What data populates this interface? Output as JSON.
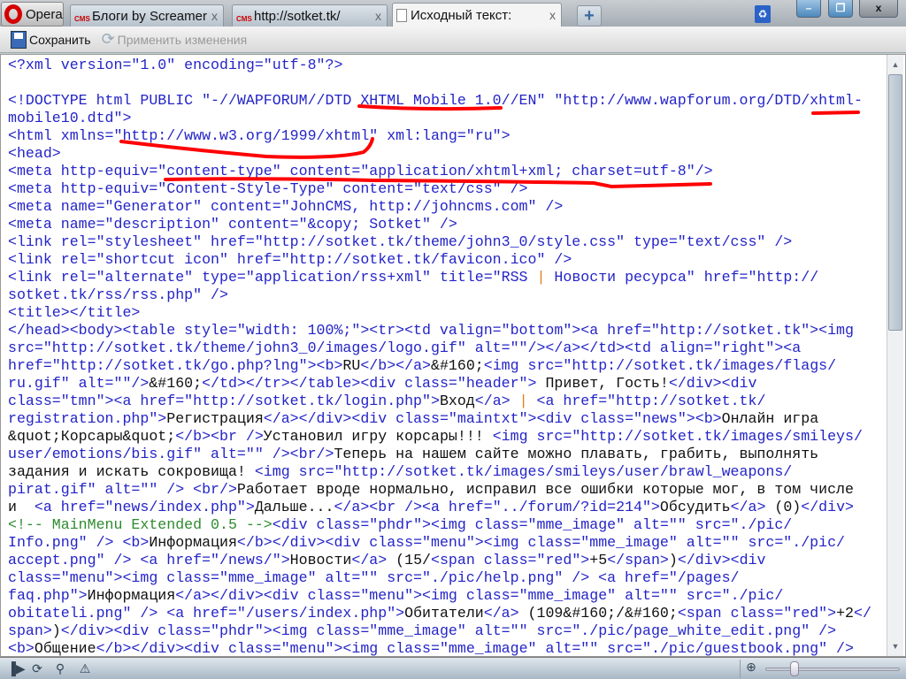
{
  "browser": {
    "menu_label": "Opera",
    "tabs": [
      {
        "title": "Блоги by Screamer",
        "icon": "cms-icon",
        "active": false
      },
      {
        "title": "http://sotket.tk/",
        "icon": "cms-icon",
        "active": false
      },
      {
        "title": "Исходный текст:",
        "icon": "page-icon",
        "active": true
      }
    ],
    "tab_close": "x",
    "new_tab": "+",
    "window_close": "x"
  },
  "toolbar": {
    "save_label": "Сохранить",
    "apply_label": "Применить изменения"
  },
  "lines": [
    [
      [
        "t",
        "<?xml version=\"1.0\" encoding=\"utf-8\"?>"
      ]
    ],
    [],
    [
      [
        "t",
        "<!DOCTYPE html PUBLIC \"-//WAPFORUM//DTD XHTML Mobile 1.0//EN\" \"http://www.wapforum.org/DTD/xhtml-"
      ]
    ],
    [
      [
        "t",
        "mobile10.dtd\">"
      ]
    ],
    [
      [
        "t",
        "<html xmlns=\"http://www.w3.org/1999/xhtml\" xml:lang=\"ru\">"
      ]
    ],
    [
      [
        "t",
        "<head>"
      ]
    ],
    [
      [
        "t",
        "<meta http-equiv=\"content-type\" content=\"application/xhtml+xml; charset=utf-8\"/>"
      ]
    ],
    [
      [
        "t",
        "<meta http-equiv=\"Content-Style-Type\" content=\"text/css\" />"
      ]
    ],
    [
      [
        "t",
        "<meta name=\"Generator\" content=\"JohnCMS, http://johncms.com\" />"
      ]
    ],
    [
      [
        "t",
        "<meta name=\"description\" content=\"&copy; Sotket\" />"
      ]
    ],
    [
      [
        "t",
        "<link rel=\"stylesheet\" href=\"http://sotket.tk/theme/john3_0/style.css\" type=\"text/css\" />"
      ]
    ],
    [
      [
        "t",
        "<link rel=\"shortcut icon\" href=\"http://sotket.tk/favicon.ico\" />"
      ]
    ],
    [
      [
        "t",
        "<link rel=\"alternate\" type=\"application/rss+xml\" title=\"RSS "
      ],
      [
        "o",
        "|"
      ],
      [
        "t",
        " Новости ресурса\" href=\"http://"
      ]
    ],
    [
      [
        "t",
        "sotket.tk/rss/rss.php\" />"
      ]
    ],
    [
      [
        "t",
        "<title></title>"
      ]
    ],
    [
      [
        "t",
        "</head><body><table style=\"width: 100%;\"><tr><td valign=\"bottom\"><a href=\"http://sotket.tk\"><img"
      ]
    ],
    [
      [
        "t",
        "src=\"http://sotket.tk/theme/john3_0/images/logo.gif\" alt=\"\"/></a></td><td align=\"right\"><a"
      ]
    ],
    [
      [
        "t",
        "href=\"http://sotket.tk/go.php?lng\"><b>"
      ],
      [
        "x",
        "RU"
      ],
      [
        "t",
        "</b></a>"
      ],
      [
        "x",
        "&#160;"
      ],
      [
        "t",
        "<img src=\"http://sotket.tk/images/flags/"
      ]
    ],
    [
      [
        "t",
        "ru.gif\" alt=\"\"/>"
      ],
      [
        "x",
        "&#160;"
      ],
      [
        "t",
        "</td></tr></table><div class=\"header\">"
      ],
      [
        "x",
        " Привет, Гость!"
      ],
      [
        "t",
        "</div><div"
      ]
    ],
    [
      [
        "t",
        "class=\"tmn\"><a href=\"http://sotket.tk/login.php\">"
      ],
      [
        "x",
        "Вход"
      ],
      [
        "t",
        "</a> "
      ],
      [
        "o",
        "|"
      ],
      [
        "t",
        " <a href=\"http://sotket.tk/"
      ]
    ],
    [
      [
        "t",
        "registration.php\">"
      ],
      [
        "x",
        "Регистрация"
      ],
      [
        "t",
        "</a></div><div class=\"maintxt\"><div class=\"news\"><b>"
      ],
      [
        "x",
        "Онлайн игра"
      ]
    ],
    [
      [
        "x",
        "&quot;Корсары&quot;"
      ],
      [
        "t",
        "</b><br />"
      ],
      [
        "x",
        "Установил игру корсары!!! "
      ],
      [
        "t",
        "<img src=\"http://sotket.tk/images/smileys/"
      ]
    ],
    [
      [
        "t",
        "user/emotions/bis.gif\" alt=\"\" /><br/>"
      ],
      [
        "x",
        "Теперь на нашем сайте можно плавать, грабить, выполнять"
      ]
    ],
    [
      [
        "x",
        "задания и искать сокровища! "
      ],
      [
        "t",
        "<img src=\"http://sotket.tk/images/smileys/user/brawl_weapons/"
      ]
    ],
    [
      [
        "t",
        "pirat.gif\" alt=\"\" /> <br/>"
      ],
      [
        "x",
        "Работает вроде нормально, исправил все ошибки которые мог, в том числе"
      ]
    ],
    [
      [
        "x",
        "и  "
      ],
      [
        "t",
        "<a href=\"news/index.php\">"
      ],
      [
        "x",
        "Дальше..."
      ],
      [
        "t",
        "</a><br /><a href=\"../forum/?id=214\">"
      ],
      [
        "x",
        "Обсудить"
      ],
      [
        "t",
        "</a>"
      ],
      [
        "x",
        " (0)"
      ],
      [
        "t",
        "</div>"
      ]
    ],
    [
      [
        "c",
        "<!-- MainMenu Extended 0.5 -->"
      ],
      [
        "t",
        "<div class=\"phdr\"><img class=\"mme_image\" alt=\"\" src=\"./pic/"
      ]
    ],
    [
      [
        "t",
        "Info.png\" /> <b>"
      ],
      [
        "x",
        "Информация"
      ],
      [
        "t",
        "</b></div><div class=\"menu\"><img class=\"mme_image\" alt=\"\" src=\"./pic/"
      ]
    ],
    [
      [
        "t",
        "accept.png\" /> <a href=\"/news/\">"
      ],
      [
        "x",
        "Новости"
      ],
      [
        "t",
        "</a>"
      ],
      [
        "x",
        " (15/"
      ],
      [
        "t",
        "<span class=\"red\">"
      ],
      [
        "x",
        "+5"
      ],
      [
        "t",
        "</span>"
      ],
      [
        "x",
        ")"
      ],
      [
        "t",
        "</div><div"
      ]
    ],
    [
      [
        "t",
        "class=\"menu\"><img class=\"mme_image\" alt=\"\" src=\"./pic/help.png\" /> <a href=\"/pages/"
      ]
    ],
    [
      [
        "t",
        "faq.php\">"
      ],
      [
        "x",
        "Информация"
      ],
      [
        "t",
        "</a></div><div class=\"menu\"><img class=\"mme_image\" alt=\"\" src=\"./pic/"
      ]
    ],
    [
      [
        "t",
        "obitateli.png\" /> <a href=\"/users/index.php\">"
      ],
      [
        "x",
        "Обитатели"
      ],
      [
        "t",
        "</a>"
      ],
      [
        "x",
        " (109&#160;/&#160;"
      ],
      [
        "t",
        "<span class=\"red\">"
      ],
      [
        "x",
        "+2"
      ],
      [
        "t",
        "</"
      ]
    ],
    [
      [
        "t",
        "span>"
      ],
      [
        "x",
        ")"
      ],
      [
        "t",
        "</div><div class=\"phdr\"><img class=\"mme_image\" alt=\"\" src=\"./pic/page_white_edit.png\" />"
      ]
    ],
    [
      [
        "t",
        "<b>"
      ],
      [
        "x",
        "Общение"
      ],
      [
        "t",
        "</b></div><div class=\"menu\"><img class=\"mme_image\" alt=\"\" src=\"./pic/guestbook.png\" />"
      ]
    ]
  ],
  "colors": {
    "tag": "#2424c8",
    "text": "#111111",
    "comment": "#2e8b2e",
    "separator": "#e08020",
    "annotation": "#ff0000"
  }
}
